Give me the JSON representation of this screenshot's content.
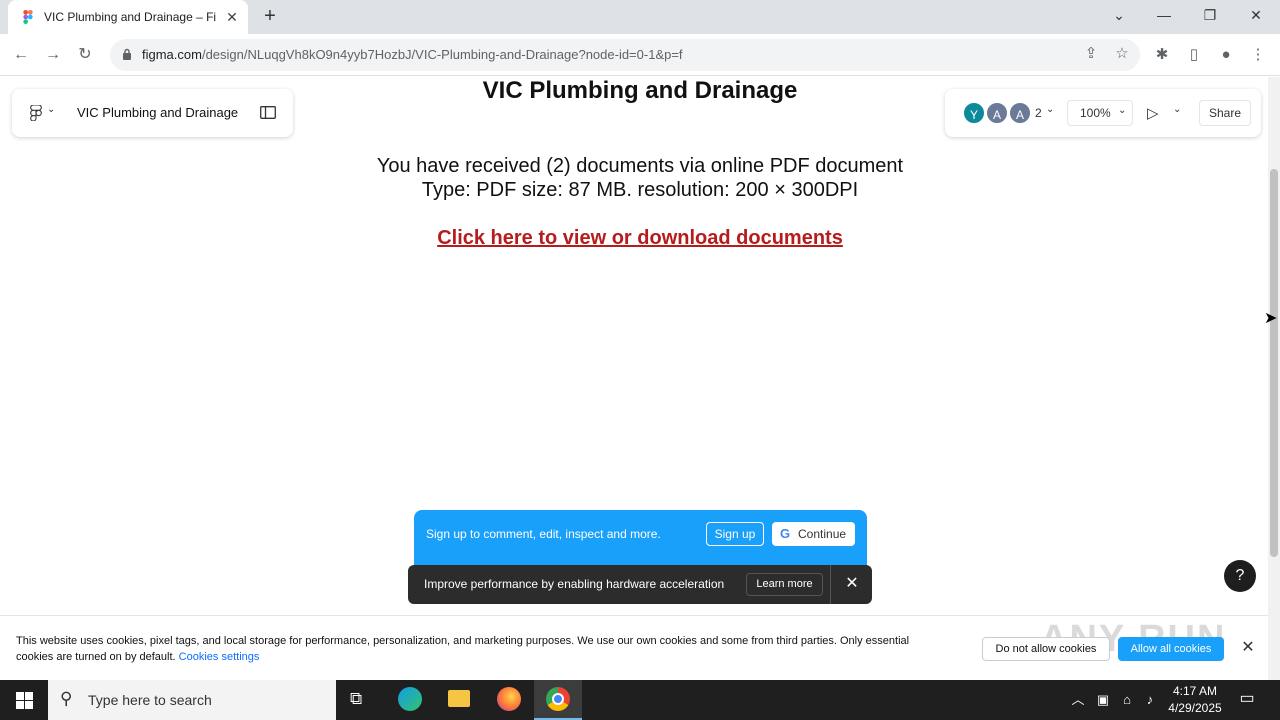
{
  "browser": {
    "tab_title": "VIC Plumbing and Drainage – Figma",
    "url_host": "figma.com",
    "url_path": "/design/NLuqgVh8kO9n4yyb7HozbJ/VIC-Plumbing-and-Drainage?node-id=0-1&p=f"
  },
  "figma": {
    "file_name": "VIC Plumbing and Drainage",
    "avatars": [
      "Y",
      "A",
      "A"
    ],
    "avatar_count": "2",
    "zoom": "100%",
    "share_label": "Share"
  },
  "document": {
    "title": "VIC Plumbing and Drainage",
    "line1": "You have received (2) documents via online PDF document",
    "line2": "Type: PDF size: 87 MB. resolution: 200 × 300DPI",
    "link": "Click here to view or download documents"
  },
  "signup": {
    "text": "Sign up to comment, edit, inspect and more.",
    "signup_label": "Sign up",
    "continue_label": "Continue"
  },
  "toast": {
    "text": "Improve performance by enabling hardware acceleration",
    "learn_more": "Learn more"
  },
  "help_label": "?",
  "cookie": {
    "text": "This website uses cookies, pixel tags, and local storage for performance, personalization, and marketing purposes. We use our own cookies and some from third parties. Only essential cookies are turned on by default.",
    "settings_link": "Cookies settings",
    "deny_label": "Do not allow cookies",
    "allow_label": "Allow all cookies"
  },
  "watermark": "ANY RUN",
  "taskbar": {
    "search_placeholder": "Type here to search",
    "time": "4:17 AM",
    "date": "4/29/2025"
  },
  "colors": {
    "figma_blue": "#18a0fb",
    "link_red": "#b71c1c",
    "taskbar": "#1f1f1f"
  }
}
